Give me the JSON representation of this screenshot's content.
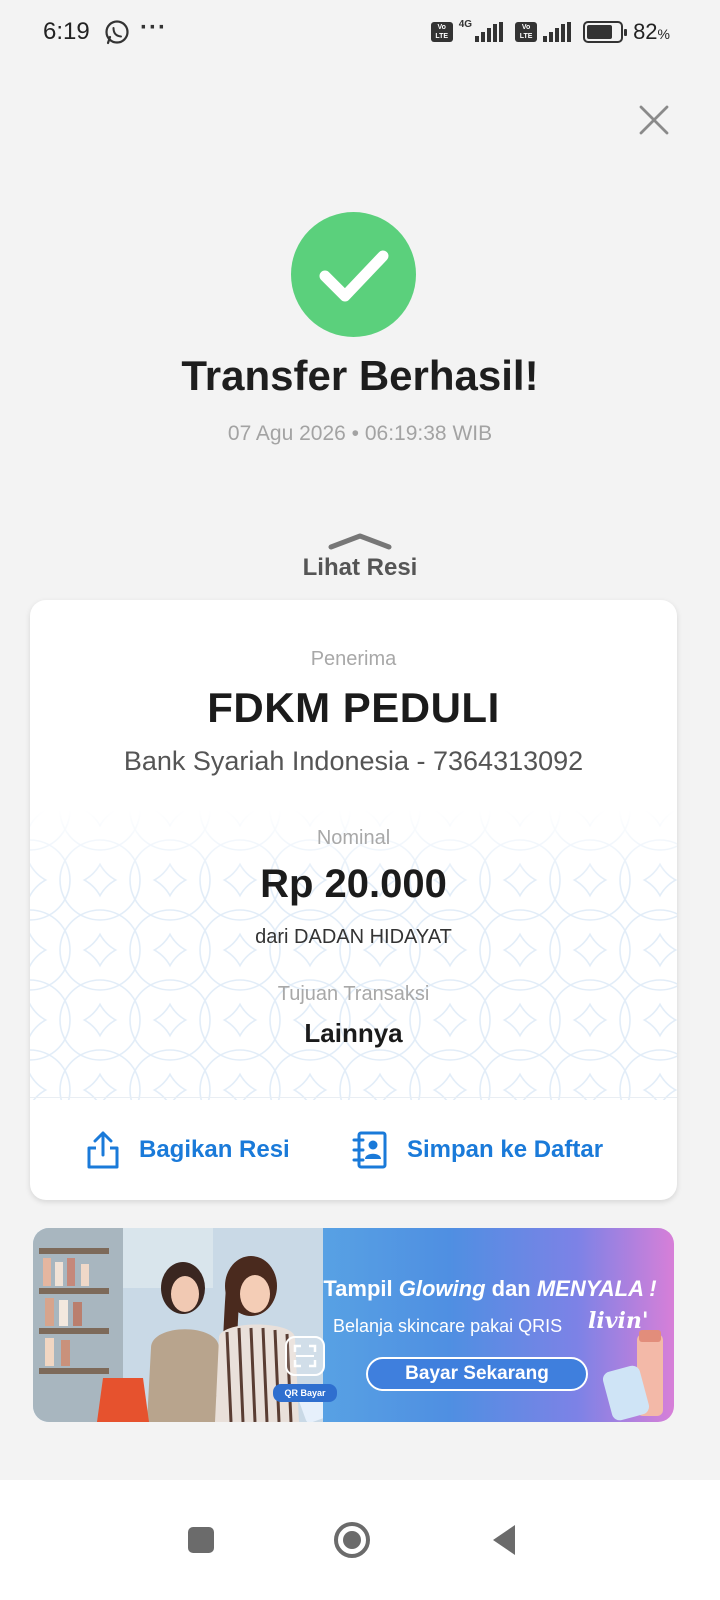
{
  "status_bar": {
    "time": "6:19",
    "more": "···",
    "network": "4G",
    "volte": "Vo LTE",
    "battery_percent": "82",
    "battery_unit": "%",
    "battery_level": 0.82
  },
  "result": {
    "title": "Transfer Berhasil!",
    "datetime": "07 Agu 2026 • 06:19:38 WIB",
    "success_color": "#5bd07c"
  },
  "receipt_toggle": {
    "label": "Lihat Resi"
  },
  "receipt": {
    "recipient_label": "Penerima",
    "recipient_name": "FDKM PEDULI",
    "recipient_bank": "Bank Syariah Indonesia - 7364313092",
    "nominal_label": "Nominal",
    "amount": "Rp 20.000",
    "from": "dari DADAN HIDAYAT",
    "purpose_label": "Tujuan Transaksi",
    "purpose": "Lainnya",
    "share_label": "Bagikan Resi",
    "save_label": "Simpan ke Daftar",
    "accent_color": "#1a7ad9"
  },
  "banner": {
    "line1_a": "Tampil ",
    "line1_b": "Glowing",
    "line1_c": " dan ",
    "line1_d": "MENYALA !",
    "line2": "Belanja skincare pakai QRIS",
    "brand": "livin'",
    "cta": "Bayar Sekarang",
    "qr_label": "QR Bayar"
  }
}
